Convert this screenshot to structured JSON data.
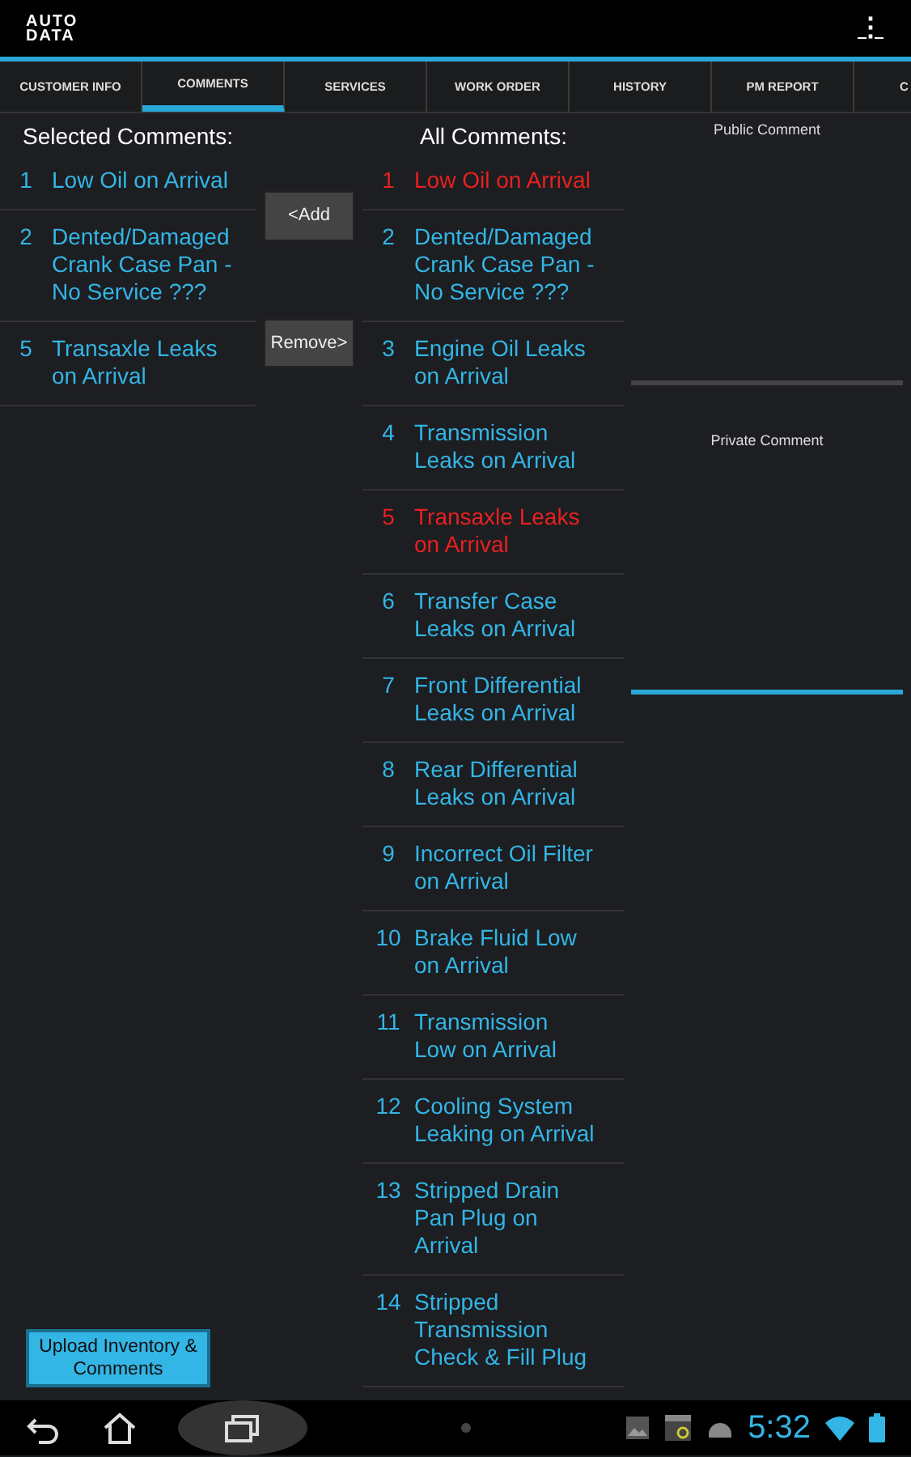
{
  "app_bar": {
    "logo_lines": [
      "AUTO",
      "DATA"
    ],
    "menu": "⋮"
  },
  "tabs": [
    {
      "label": "CUSTOMER INFO",
      "selected": false
    },
    {
      "label": "COMMENTS",
      "selected": true
    },
    {
      "label": "SERVICES",
      "selected": false
    },
    {
      "label": "WORK ORDER",
      "selected": false
    },
    {
      "label": "HISTORY",
      "selected": false
    },
    {
      "label": "PM REPORT",
      "selected": false
    },
    {
      "label": "C",
      "selected": false
    }
  ],
  "selected_comments": {
    "title": "Selected Comments:",
    "items": [
      {
        "number": "1",
        "text": "Low Oil on Arrival"
      },
      {
        "number": "2",
        "text": "Dented/Damaged Crank Case Pan - No Service ???"
      },
      {
        "number": "5",
        "text": "Transaxle Leaks on Arrival"
      }
    ]
  },
  "buttons": [
    {
      "label": "<Add"
    },
    {
      "label": "Remove>"
    }
  ],
  "all_comments": {
    "title": "All Comments:",
    "items": [
      {
        "number": "1",
        "text": "Low Oil on Arrival",
        "selected": true
      },
      {
        "number": "2",
        "text": "Dented/Damaged Crank Case Pan - No Service ???",
        "selected": false
      },
      {
        "number": "3",
        "text": "Engine Oil Leaks on Arrival",
        "selected": false
      },
      {
        "number": "4",
        "text": "Transmission Leaks on Arrival",
        "selected": false
      },
      {
        "number": "5",
        "text": "Transaxle Leaks on Arrival",
        "selected": true
      },
      {
        "number": "6",
        "text": "Transfer Case Leaks on Arrival",
        "selected": false
      },
      {
        "number": "7",
        "text": "Front Differential Leaks on Arrival",
        "selected": false
      },
      {
        "number": "8",
        "text": "Rear Differential Leaks on Arrival",
        "selected": false
      },
      {
        "number": "9",
        "text": "Incorrect Oil Filter on Arrival",
        "selected": false
      },
      {
        "number": "10",
        "text": "Brake Fluid Low on Arrival",
        "selected": false
      },
      {
        "number": "11",
        "text": "Transmission Low on Arrival",
        "selected": false
      },
      {
        "number": "12",
        "text": "Cooling System Leaking on Arrival",
        "selected": false
      },
      {
        "number": "13",
        "text": "Stripped Drain Pan Plug on Arrival",
        "selected": false
      },
      {
        "number": "14",
        "text": "Stripped Transmission Check & Fill Plug",
        "selected": false
      }
    ]
  },
  "comment_fields": [
    {
      "label": "Public Comment",
      "focused": false
    },
    {
      "label": "Private Comment",
      "focused": true
    }
  ],
  "upload_button": {
    "label": "Upload Inventory & Comments"
  },
  "system_bar": {
    "time": "5:32"
  }
}
